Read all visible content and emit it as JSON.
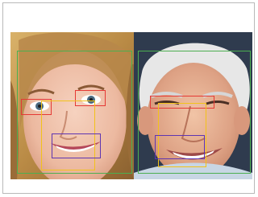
{
  "figure": {
    "subjects": [
      {
        "label": "woman-face"
      },
      {
        "label": "man-face"
      }
    ],
    "box_colors": {
      "face": "#4caf50",
      "eye": "#e53935",
      "nose": "#f2c21a",
      "mouth": "#5e35b1"
    }
  }
}
